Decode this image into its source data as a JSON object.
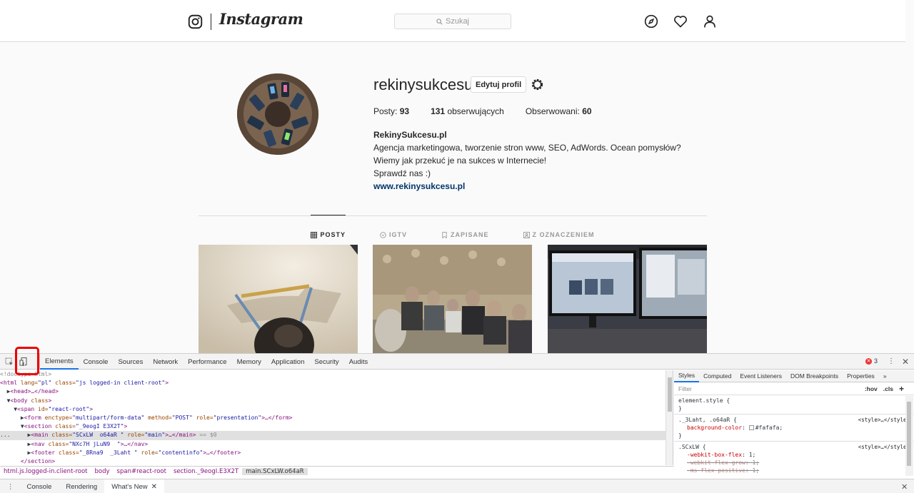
{
  "ig": {
    "wordmark": "Instagram",
    "search_placeholder": "Szukaj",
    "username": "rekinysukcesu",
    "edit_profile_label": "Edytuj profil",
    "stats": {
      "posts_label": "Posty:",
      "posts_count": "93",
      "followers_count": "131",
      "followers_label": "obserwujących",
      "following_label": "Obserwowani:",
      "following_count": "60"
    },
    "bio": {
      "name": "RekinySukcesu.pl",
      "line1": "Agencja marketingowa, tworzenie stron www, SEO, AdWords. Ocean pomysłów?",
      "line2": "Wiemy jak przekuć je na sukces w Internecie!",
      "line3": "Sprawdź nas :)",
      "link": "www.rekinysukcesu.pl"
    },
    "tabs": [
      {
        "label": "POSTY",
        "icon": "grid-icon"
      },
      {
        "label": "IGTV",
        "icon": "igtv-icon"
      },
      {
        "label": "ZAPISANE",
        "icon": "bookmark-icon"
      },
      {
        "label": "Z OZNACZENIEM",
        "icon": "tagged-icon"
      }
    ],
    "colors": {
      "link": "#003569",
      "border": "#dbdbdb",
      "muted": "#999999"
    }
  },
  "devtools": {
    "tabs": [
      "Elements",
      "Console",
      "Sources",
      "Network",
      "Performance",
      "Memory",
      "Application",
      "Security",
      "Audits"
    ],
    "error_count": "3",
    "dom_lines": {
      "l0": "<!doctype html>",
      "l1_tag": "<html ",
      "l1_attr1": "lang=",
      "l1_val1": "\"pl\"",
      "l1_attr2": " class=",
      "l1_val2": "\"js logged-in client-root\"",
      "l1_end": ">",
      "l2": "<head>…</head>",
      "l3_tag": "<body ",
      "l3_attr": "class",
      "l3_end": ">",
      "l4_tag": "<span ",
      "l4_attr": "id=",
      "l4_val": "\"react-root\"",
      "l4_end": ">",
      "l5_tag": "<form ",
      "l5_attr1": "enctype=",
      "l5_val1": "\"multipart/form-data\"",
      "l5_attr2": " method=",
      "l5_val2": "\"POST\"",
      "l5_attr3": " role=",
      "l5_val3": "\"presentation\"",
      "l5_end": ">…</form>",
      "l6_tag": "<section ",
      "l6_attr": "class=",
      "l6_val": "\"_9eogI E3X2T\"",
      "l6_end": ">",
      "l7_tag": "<main ",
      "l7_attr1": "class=",
      "l7_val1": "\"SCxLW  o64aR \"",
      "l7_attr2": " role=",
      "l7_val2": "\"main\"",
      "l7_end": ">…</main>",
      "l7_eq": " == $0",
      "l8_tag": "<nav ",
      "l8_attr": "class=",
      "l8_val": "\"NXc7H jLuN9  \"",
      "l8_end": ">…</nav>",
      "l9_tag": "<footer ",
      "l9_attr1": "class=",
      "l9_val1": "\"_8Rna9  _3Laht \"",
      "l9_attr2": " role=",
      "l9_val2": "\"contentinfo\"",
      "l9_end": ">…</footer>",
      "l10": "</section>"
    },
    "breadcrumbs": [
      "html.js.logged-in.client-root",
      "body",
      "span#react-root",
      "section._9eogI.E3X2T",
      "main.SCxLW.o64aR"
    ],
    "styles_tabs": [
      "Styles",
      "Computed",
      "Event Listeners",
      "DOM Breakpoints",
      "Properties"
    ],
    "filter_placeholder": "Filter",
    "hov_label": ":hov",
    "cls_label": ".cls",
    "rules": {
      "r1_selector": "element.style {",
      "r1_close": "}",
      "r2_selector": "._3Laht, .o64aR {",
      "r2_source": "<style>…</style>",
      "r2_prop": "background-color",
      "r2_value": "#fafafa;",
      "r2_close": "}",
      "r3_selector": ".SCxLW {",
      "r3_source": "<style>…</style>",
      "r3_p1": "-webkit-box-flex",
      "r3_v1": "1;",
      "r3_p2": "-webkit-flex-grow",
      "r3_v2": "1;",
      "r3_p3": "-ms-flex-positive",
      "r3_v3": "1;"
    },
    "drawer_tabs": [
      "Console",
      "Rendering",
      "What's New"
    ]
  }
}
